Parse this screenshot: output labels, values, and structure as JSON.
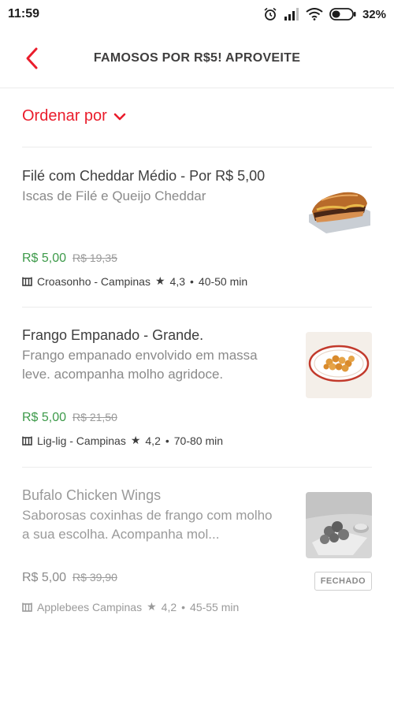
{
  "status_bar": {
    "time": "11:59",
    "battery": "32%",
    "icons": [
      "alarm-icon",
      "signal-icon",
      "wifi-icon",
      "battery-icon"
    ]
  },
  "header": {
    "title": "FAMOSOS POR R$5! APROVEITE",
    "back_icon": "chevron-left-icon"
  },
  "sort": {
    "label": "Ordenar por",
    "icon": "chevron-down-icon"
  },
  "colors": {
    "accent": "#ea1d2c",
    "price_green": "#3d9a4a"
  },
  "items": [
    {
      "title": "Filé com Cheddar Médio - Por R$ 5,00",
      "description": "Iscas de Filé  e Queijo Cheddar",
      "price": "R$ 5,00",
      "old_price": "R$ 19,35",
      "store": "Croasonho - Campinas",
      "rating": "4,3",
      "time": "40-50 min",
      "status": "open"
    },
    {
      "title": "Frango Empanado - Grande.",
      "description": "Frango empanado envolvido em massa leve. acompanha molho agridoce.",
      "price": "R$ 5,00",
      "old_price": "R$ 21,50",
      "store": "Lig-lig - Campinas",
      "rating": "4,2",
      "time": "70-80 min",
      "status": "open"
    },
    {
      "title": "Bufalo Chicken Wings",
      "description": "Saborosas coxinhas de frango com molho a sua escolha. Acompanha mol...",
      "price": "R$ 5,00",
      "old_price": "R$ 39,90",
      "store": "Applebees Campinas",
      "rating": "4,2",
      "time": "45-55 min",
      "status": "closed",
      "badge": "FECHADO"
    }
  ]
}
